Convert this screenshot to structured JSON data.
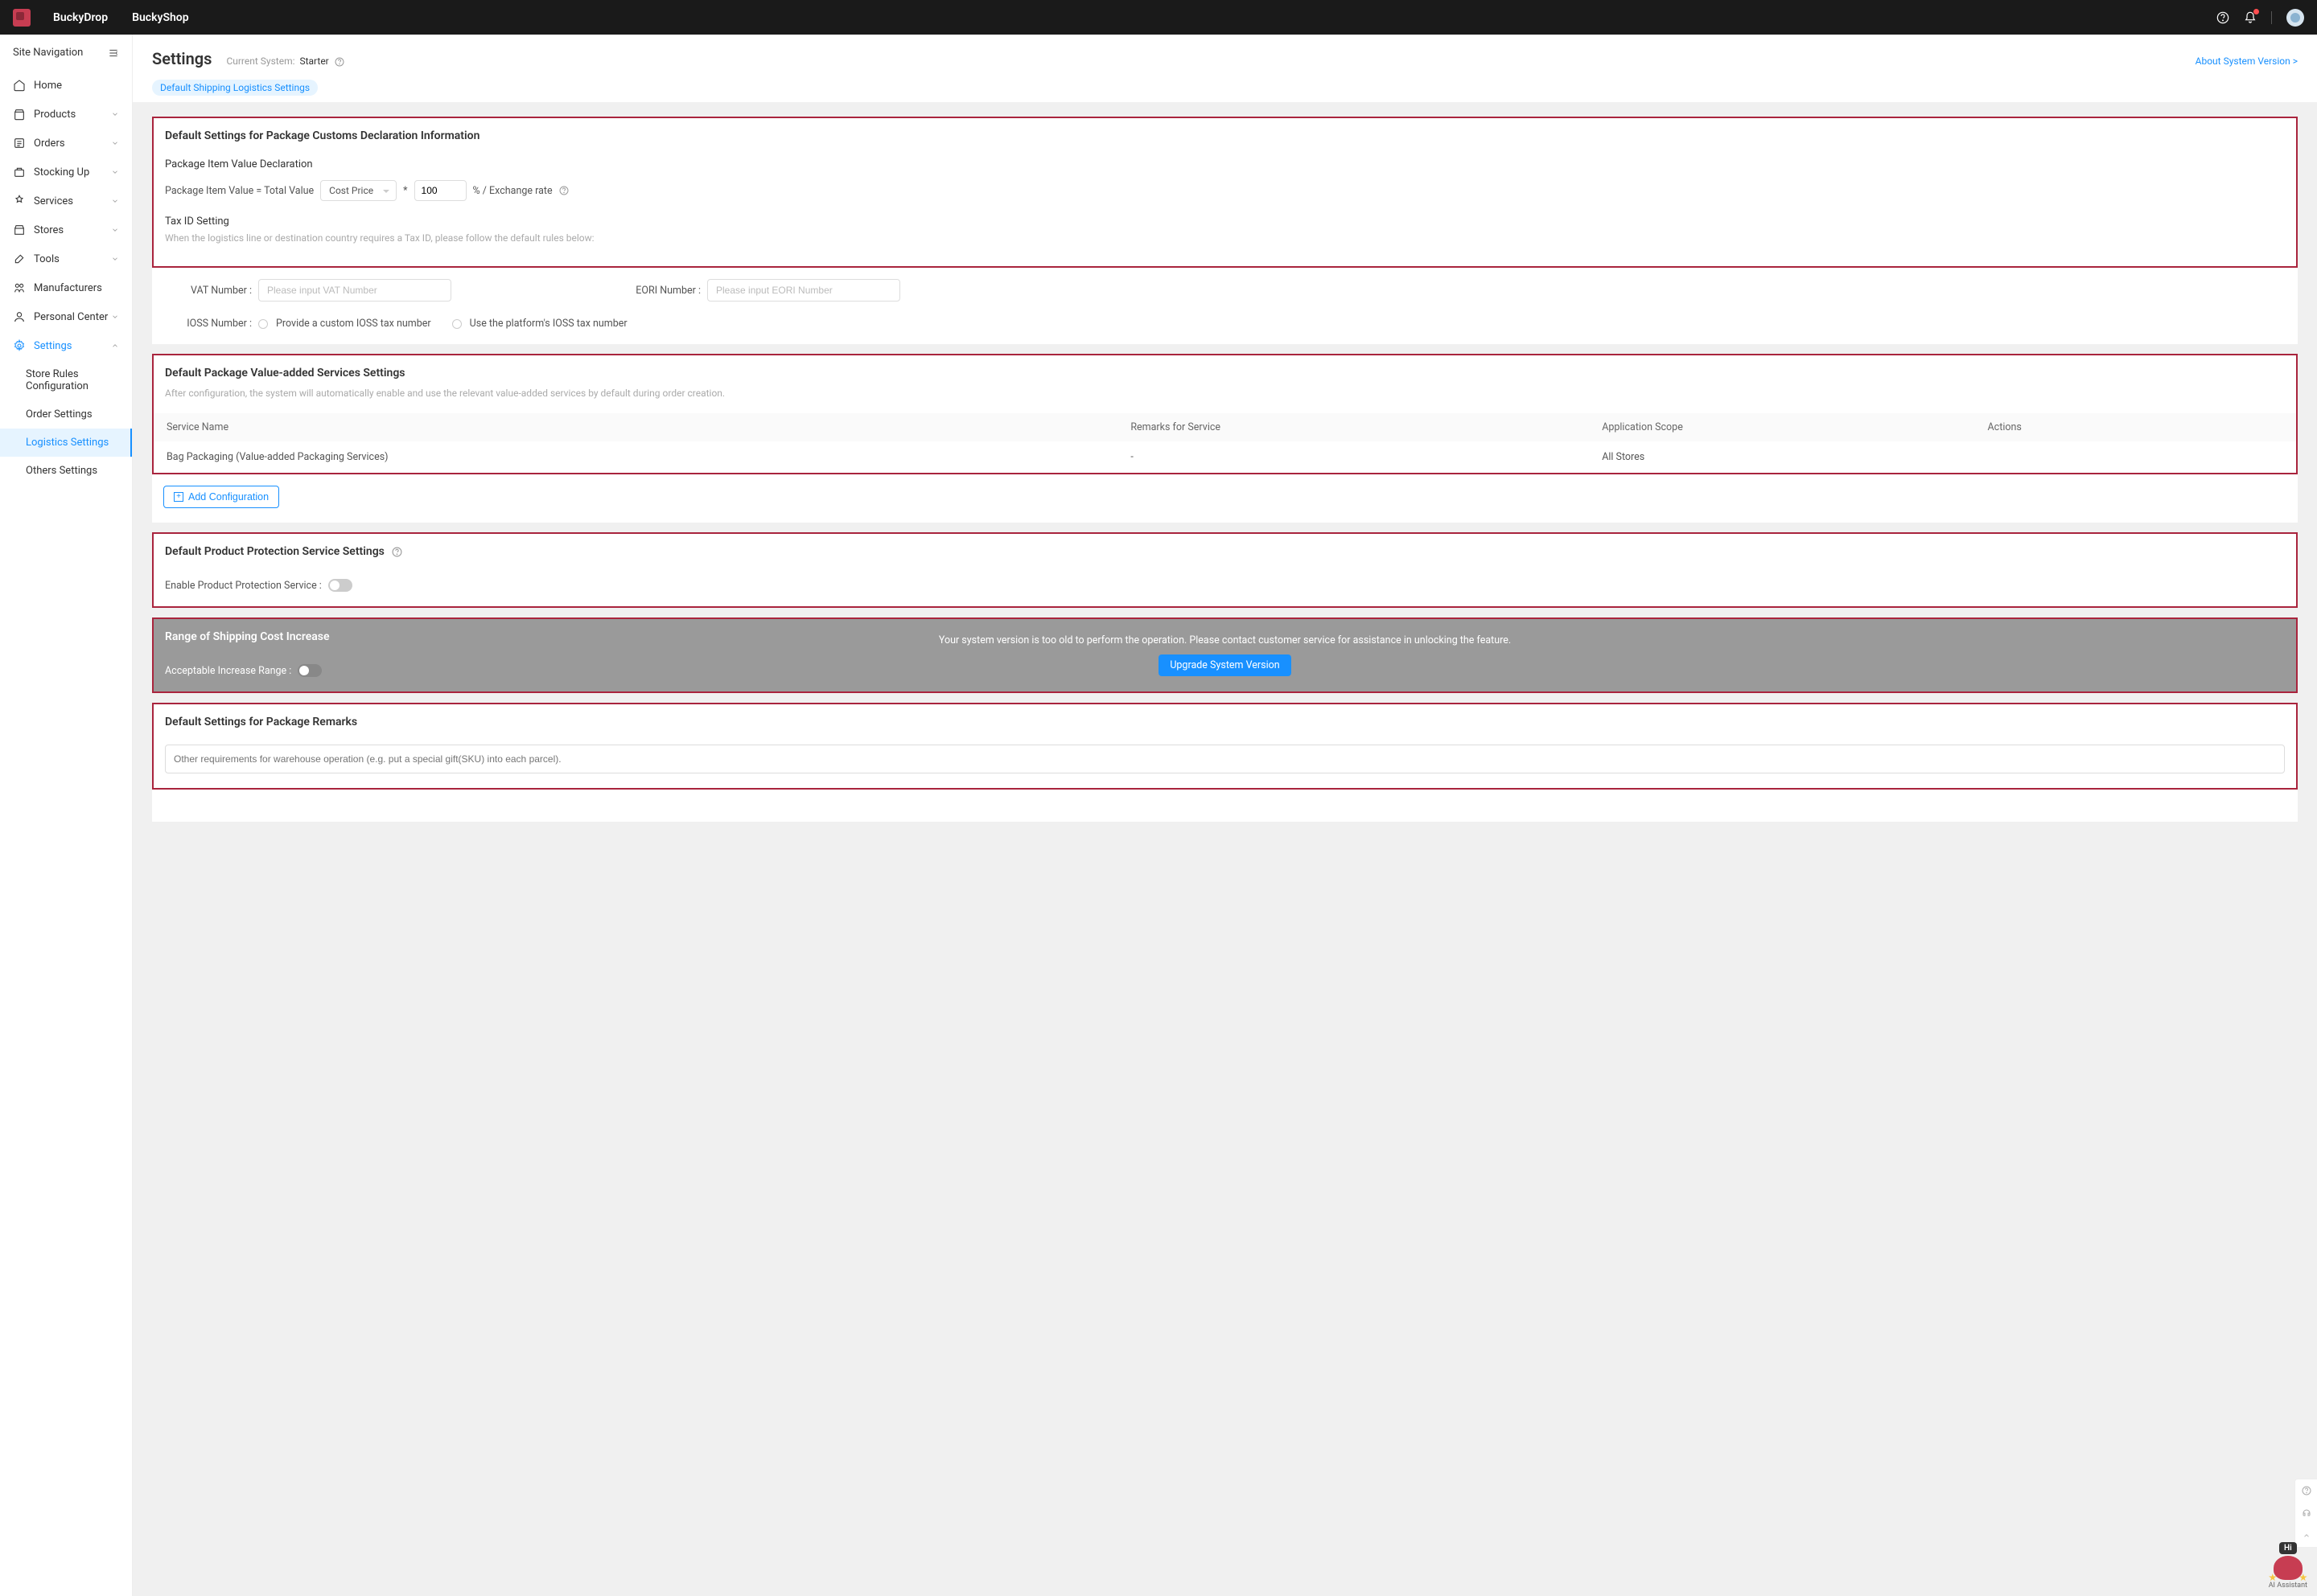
{
  "header": {
    "brand1": "BuckyDrop",
    "brand2": "BuckyShop"
  },
  "sidebar": {
    "title": "Site Navigation",
    "items": [
      {
        "label": "Home",
        "expandable": false
      },
      {
        "label": "Products",
        "expandable": true
      },
      {
        "label": "Orders",
        "expandable": true
      },
      {
        "label": "Stocking Up",
        "expandable": true
      },
      {
        "label": "Services",
        "expandable": true
      },
      {
        "label": "Stores",
        "expandable": true
      },
      {
        "label": "Tools",
        "expandable": true
      },
      {
        "label": "Manufacturers",
        "expandable": false
      },
      {
        "label": "Personal Center",
        "expandable": true
      },
      {
        "label": "Settings",
        "expandable": true,
        "active": true
      }
    ],
    "subitems": [
      {
        "label": "Store Rules Configuration"
      },
      {
        "label": "Order Settings"
      },
      {
        "label": "Logistics Settings",
        "selected": true
      },
      {
        "label": "Others Settings"
      }
    ]
  },
  "page": {
    "title": "Settings",
    "current_system_label": "Current System:",
    "current_system_value": "Starter",
    "about_link": "About System Version >",
    "breadcrumb": "Default Shipping Logistics Settings"
  },
  "customs": {
    "title": "Default Settings for Package Customs Declaration Information",
    "decl_label": "Package Item Value Declaration",
    "formula_prefix": "Package Item Value = Total Value",
    "price_type": "Cost Price",
    "multiplier": "100",
    "suffix": "% / Exchange rate",
    "taxid_title": "Tax ID Setting",
    "taxid_hint": "When the logistics line or destination country requires a Tax ID, please follow the default rules below:",
    "vat_label": "VAT Number :",
    "vat_placeholder": "Please input VAT Number",
    "eori_label": "EORI Number :",
    "eori_placeholder": "Please input EORI Number",
    "ioss_label": "IOSS Number :",
    "ioss_opt1": "Provide a custom IOSS tax number",
    "ioss_opt2": "Use the platform's IOSS tax number"
  },
  "vas": {
    "title": "Default Package Value-added Services Settings",
    "note": "After configuration, the system will automatically enable and use the relevant value-added services by default during order creation.",
    "cols": {
      "c1": "Service Name",
      "c2": "Remarks for Service",
      "c3": "Application Scope",
      "c4": "Actions"
    },
    "rows": [
      {
        "name": "Bag Packaging (Value-added Packaging Services)",
        "remarks": "-",
        "scope": "All Stores",
        "actions": ""
      }
    ],
    "add_btn": "Add Configuration"
  },
  "protection": {
    "title": "Default Product Protection Service Settings",
    "enable_label": "Enable Product Protection Service :"
  },
  "shipping": {
    "title": "Range of Shipping Cost Increase",
    "range_label": "Acceptable Increase Range :",
    "overlay_msg": "Your system version is too old to perform the operation. Please contact customer service for assistance in unlocking the feature.",
    "upgrade_btn": "Upgrade System Version"
  },
  "remarks": {
    "title": "Default Settings for Package Remarks",
    "placeholder": "Other requirements for warehouse operation (e.g. put a special gift(SKU) into each parcel)."
  },
  "ai": {
    "hi": "Hi",
    "label": "AI Assistant"
  }
}
